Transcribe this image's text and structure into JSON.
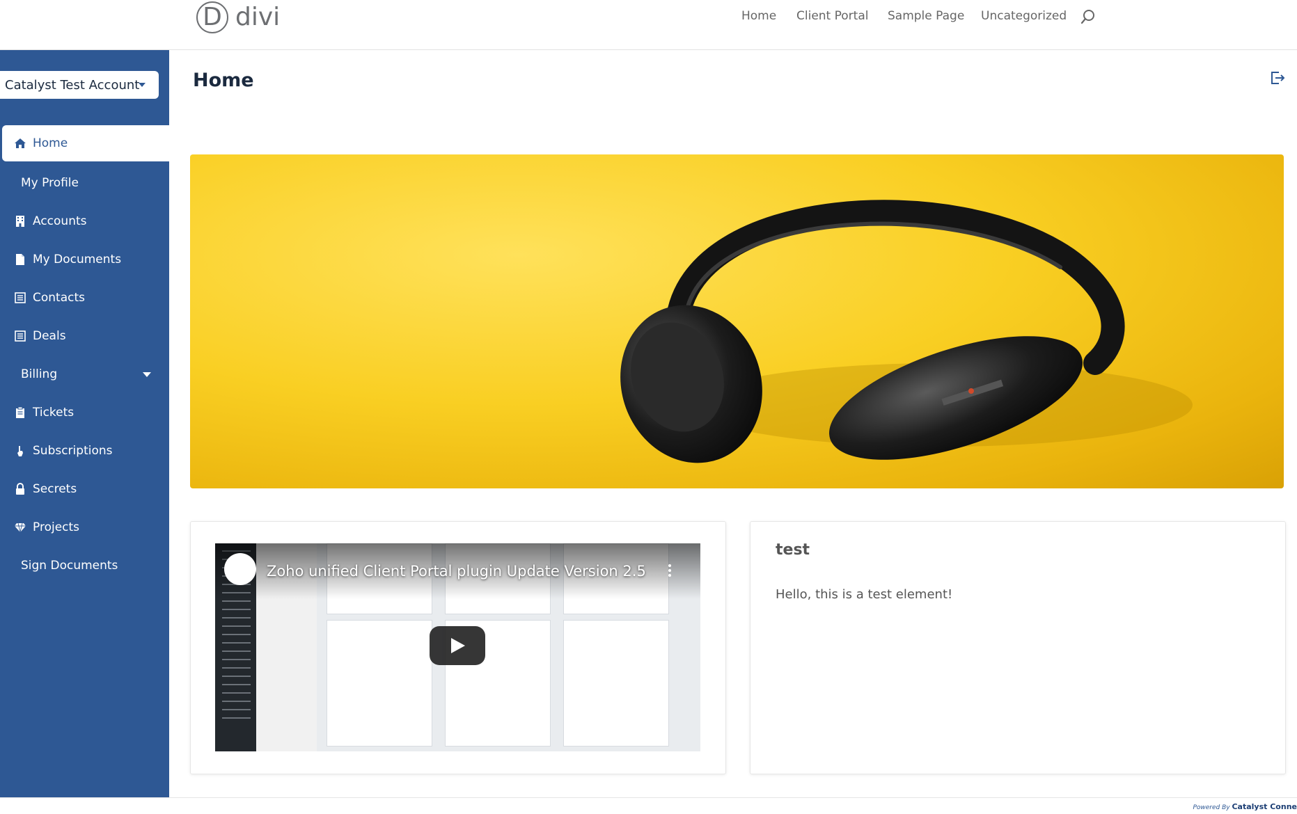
{
  "header": {
    "logo_letter": "D",
    "logo_text": "divi",
    "nav": [
      "Home",
      "Client Portal",
      "Sample Page",
      "Uncategorized"
    ]
  },
  "sidebar": {
    "account": "Catalyst Test Account",
    "items": [
      {
        "label": "Home",
        "icon": "home-icon"
      },
      {
        "label": "My Profile",
        "icon": ""
      },
      {
        "label": "Accounts",
        "icon": "building-icon"
      },
      {
        "label": "My Documents",
        "icon": "document-icon"
      },
      {
        "label": "Contacts",
        "icon": "list-icon"
      },
      {
        "label": "Deals",
        "icon": "list-icon"
      },
      {
        "label": "Billing",
        "icon": ""
      },
      {
        "label": "Tickets",
        "icon": "clipboard-icon"
      },
      {
        "label": "Subscriptions",
        "icon": "hand-icon"
      },
      {
        "label": "Secrets",
        "icon": "lock-icon"
      },
      {
        "label": "Projects",
        "icon": "diamond-icon"
      },
      {
        "label": "Sign Documents",
        "icon": ""
      }
    ]
  },
  "main": {
    "title": "Home",
    "video_title": "Zoho unified Client Portal plugin Update Version 2.5",
    "card_title": "test",
    "card_body": "Hello, this is a test element!"
  },
  "footer": {
    "powered_by": "Powered By",
    "brand": "Catalyst Conne"
  },
  "colors": {
    "sidebar": "#2e5894",
    "hero": "#f9cf23"
  }
}
